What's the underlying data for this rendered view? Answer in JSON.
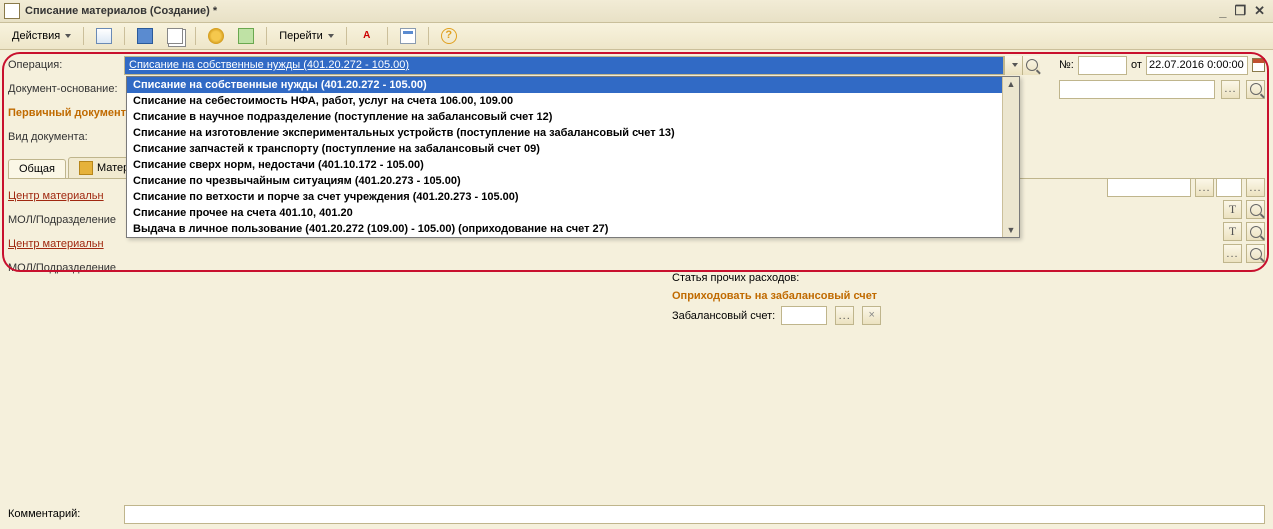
{
  "window": {
    "title": "Списание материалов (Создание) *"
  },
  "toolbar": {
    "actions": "Действия",
    "go": "Перейти"
  },
  "labels": {
    "operation": "Операция:",
    "doc_base": "Документ-основание:",
    "primary_doc": "Первичный документ",
    "doc_type": "Вид документа:",
    "center_mat": "Центр материальн",
    "mol_dept": "МОЛ/Подразделение",
    "number": "№:",
    "from": "от",
    "stat_rash": "Статья прочих расходов:",
    "obal_title": "Оприходовать на забалансовый счет",
    "obal_account": "Забалансовый счет:",
    "comment": "Комментарий:"
  },
  "values": {
    "operation_selected": "Списание на собственные нужды (401.20.272 - 105.00)",
    "date": "22.07.2016 0:00:00"
  },
  "tabs": {
    "general": "Общая",
    "materials": "Матер"
  },
  "dropdown": {
    "items": [
      "Списание на собственные нужды (401.20.272 - 105.00)",
      "Списание на себестоимость НФА, работ, услуг на счета 106.00, 109.00",
      "Списание в научное подразделение (поступление на забалансовый счет 12)",
      "Списание на изготовление экспериментальных устройств (поступление на забалансовый счет 13)",
      "Списание запчастей к транспорту (поступление на забалансовый счет 09)",
      "Списание сверх норм, недостачи (401.10.172 - 105.00)",
      "Списание по чрезвычайным ситуациям (401.20.273 - 105.00)",
      "Списание по ветхости и порче за счет учреждения (401.20.273 - 105.00)",
      "Списание прочее на счета 401.10, 401.20",
      "Выдача в личное пользование (401.20.272 (109.00) - 105.00) (оприходование на счет 27)"
    ]
  },
  "icons": {
    "help": "?",
    "akt": "А",
    "close": "×",
    "dots": "..."
  }
}
